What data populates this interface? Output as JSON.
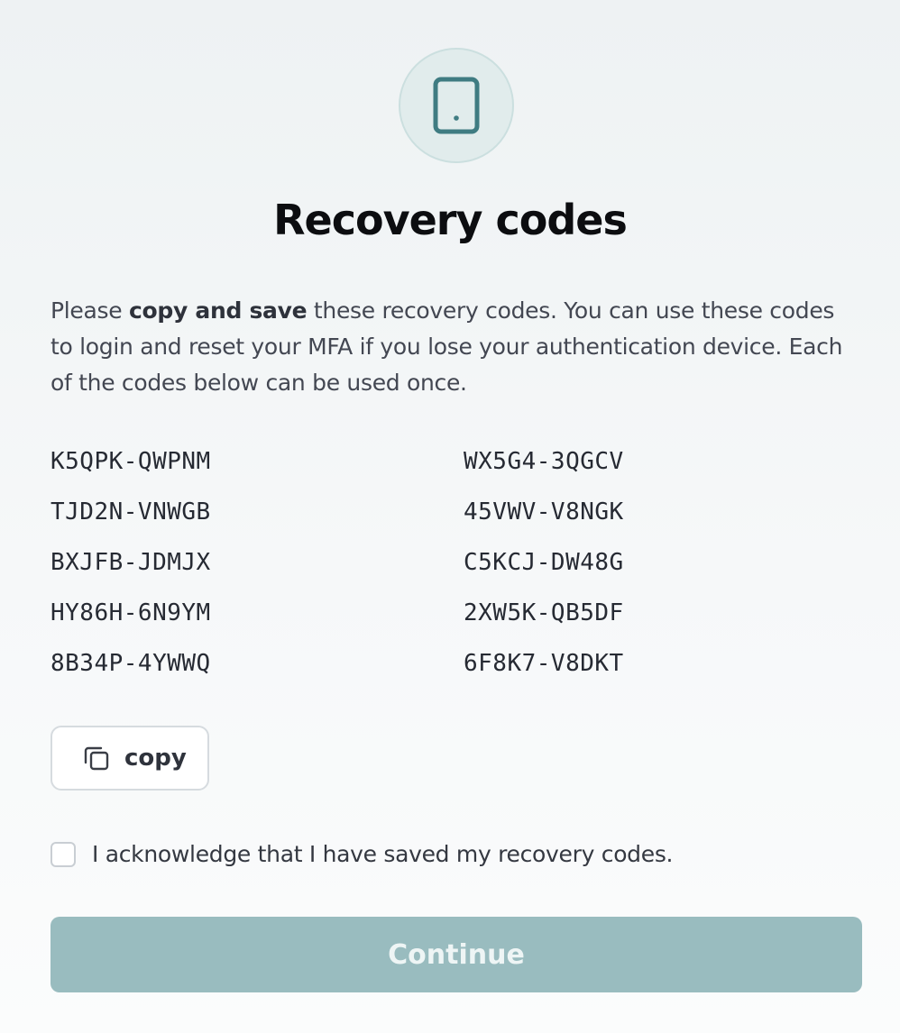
{
  "header": {
    "icon": "tablet-icon",
    "title": "Recovery codes"
  },
  "description": {
    "prefix": "Please ",
    "emphasis": "copy and save",
    "suffix": " these recovery codes. You can use these codes to login and reset your MFA if you lose your authentication device. Each of the codes below can be used once."
  },
  "codes": [
    "K5QPK-QWPNM",
    "WX5G4-3QGCV",
    "TJD2N-VNWGB",
    "45VWV-V8NGK",
    "BXJFB-JDMJX",
    "C5KCJ-DW48G",
    "HY86H-6N9YM",
    "2XW5K-QB5DF",
    "8B34P-4YWWQ",
    "6F8K7-V8DKT"
  ],
  "copy_button": {
    "icon": "copy-icon",
    "label": "copy"
  },
  "acknowledge": {
    "checked": false,
    "label": "I acknowledge that I have saved my recovery codes."
  },
  "continue_button": {
    "label": "Continue",
    "enabled": false
  },
  "colors": {
    "accent": "#3f7c82",
    "icon_bg": "#e1ecec",
    "button_disabled": "#99bcbf",
    "title": "#0c0d10",
    "text": "#434752"
  }
}
